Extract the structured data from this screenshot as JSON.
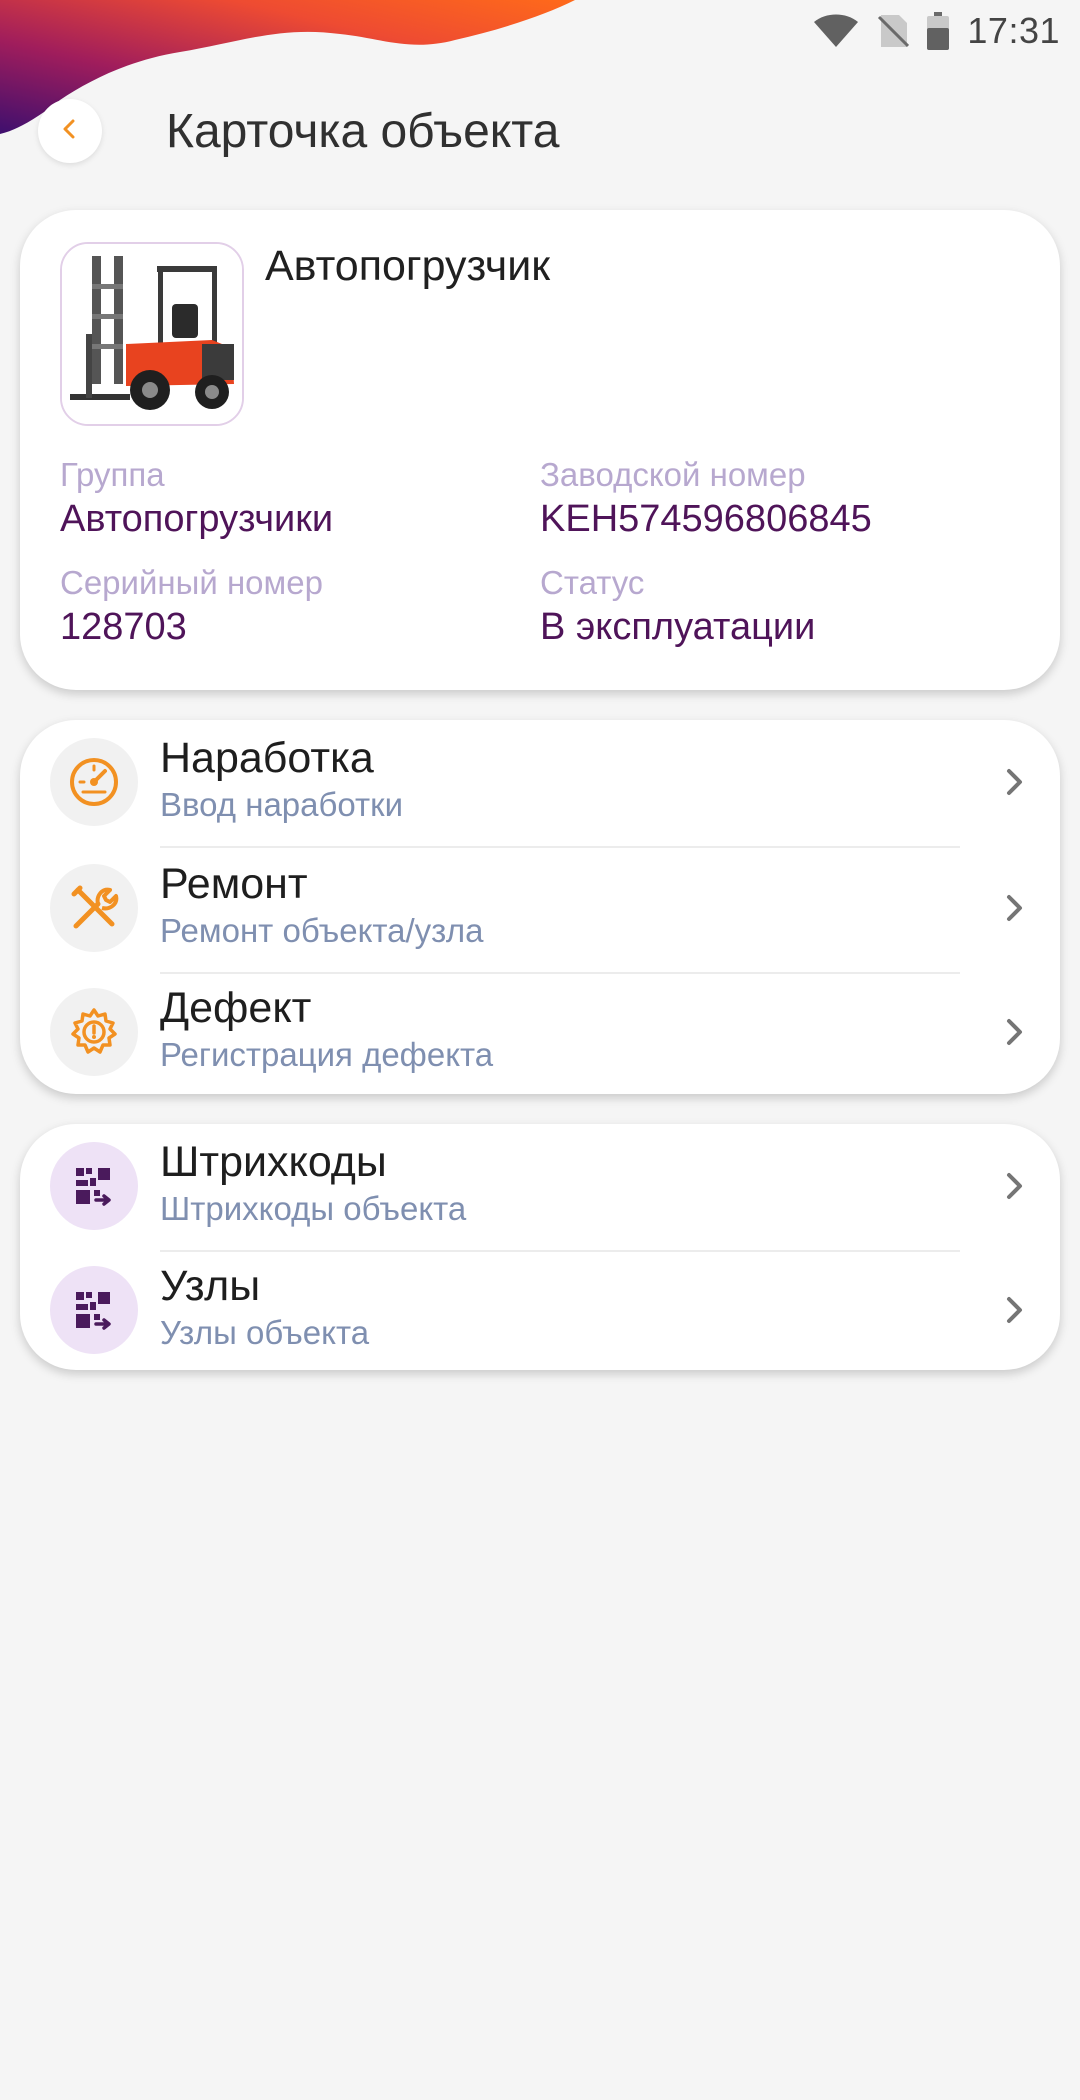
{
  "status_bar": {
    "time": "17:31"
  },
  "header": {
    "title": "Карточка объекта"
  },
  "object": {
    "name": "Автопогрузчик",
    "fields": {
      "group": {
        "label": "Группа",
        "value": "Автопогрузчики"
      },
      "factory_number": {
        "label": "Заводской номер",
        "value": "KEH574596806845"
      },
      "serial_number": {
        "label": "Серийный номер",
        "value": "128703"
      },
      "status": {
        "label": "Статус",
        "value": "В эксплуатации"
      }
    }
  },
  "actions": [
    {
      "title": "Наработка",
      "subtitle": "Ввод наработки",
      "icon": "speedometer-icon"
    },
    {
      "title": "Ремонт",
      "subtitle": "Ремонт объекта/узла",
      "icon": "tools-icon"
    },
    {
      "title": "Дефект",
      "subtitle": "Регистрация дефекта",
      "icon": "defect-gear-icon"
    }
  ],
  "links": [
    {
      "title": "Штрихкоды",
      "subtitle": "Штрихкоды объекта",
      "icon": "qr-code-icon"
    },
    {
      "title": "Узлы",
      "subtitle": "Узлы объекта",
      "icon": "qr-code-icon"
    }
  ],
  "colors": {
    "accent_orange": "#f29122",
    "value_purple": "#4f1459",
    "label_lilac": "#b7a8cf",
    "subtitle_blue_grey": "#7f8fb0",
    "qr_purple": "#4a1a5c"
  }
}
